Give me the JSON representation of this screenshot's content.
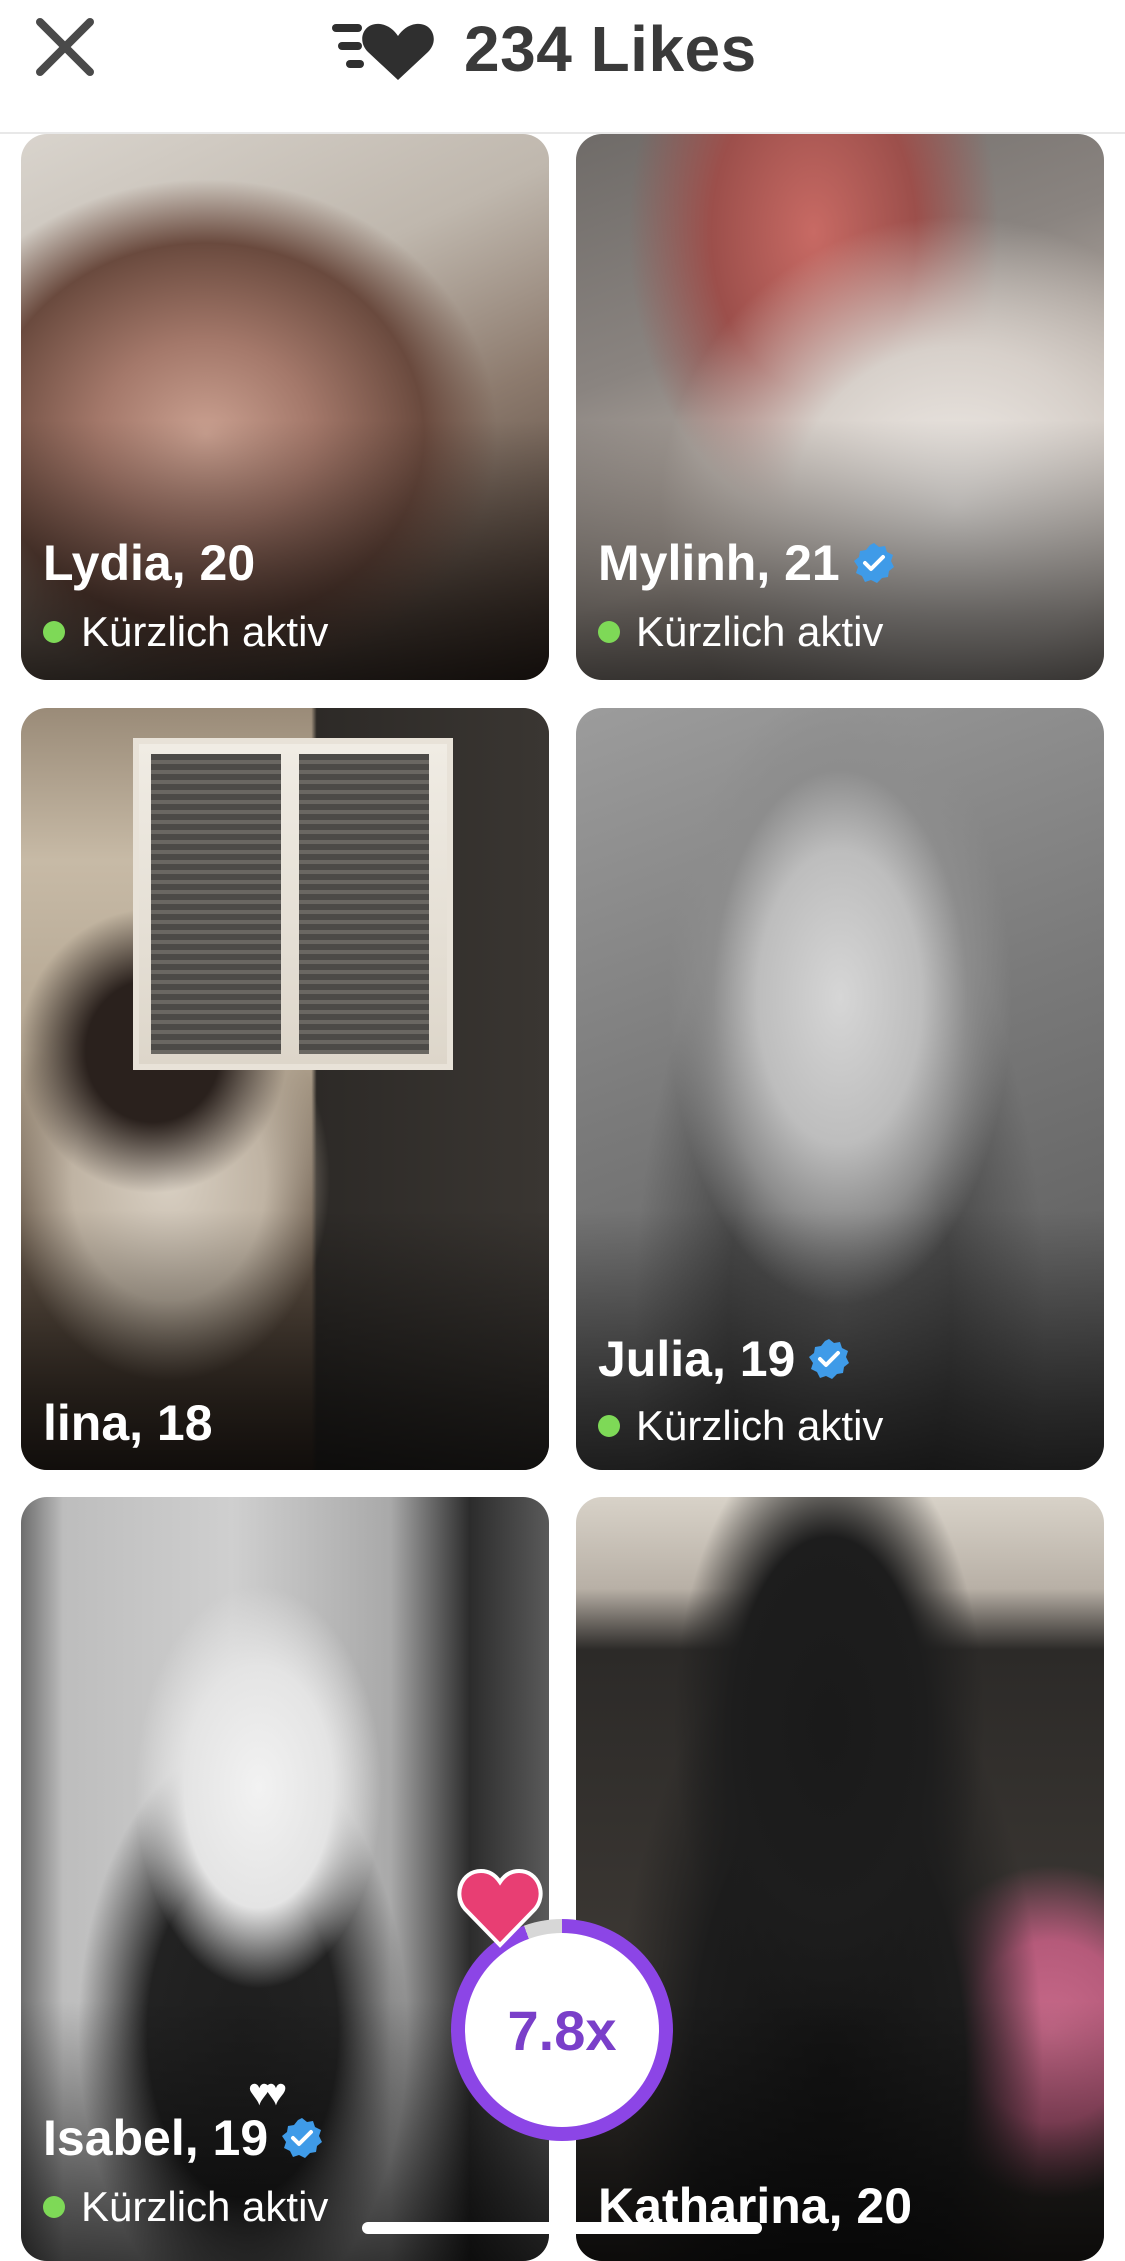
{
  "header": {
    "title": "234 Likes",
    "close_icon": "close-icon",
    "likes_icon": "speed-heart-icon"
  },
  "cards": [
    {
      "name": "Lydia, 20",
      "status": "Kürzlich aktiv",
      "verified": false
    },
    {
      "name": "Mylinh, 21",
      "status": "Kürzlich aktiv",
      "verified": true
    },
    {
      "name": "lina, 18",
      "status": "",
      "verified": false
    },
    {
      "name": "Julia, 19",
      "status": "Kürzlich aktiv",
      "verified": true
    },
    {
      "name": "Isabel, 19",
      "status": "Kürzlich aktiv",
      "verified": true
    },
    {
      "name": "Katharina, 20",
      "status": "",
      "verified": false
    }
  ],
  "booster": {
    "multiplier": "7.8x",
    "progress": 0.94,
    "ring_color": "#8c45e6",
    "heart_color": "#e83e73"
  },
  "colors": {
    "active_dot": "#7ed957",
    "verified_badge": "#3f9be8"
  }
}
